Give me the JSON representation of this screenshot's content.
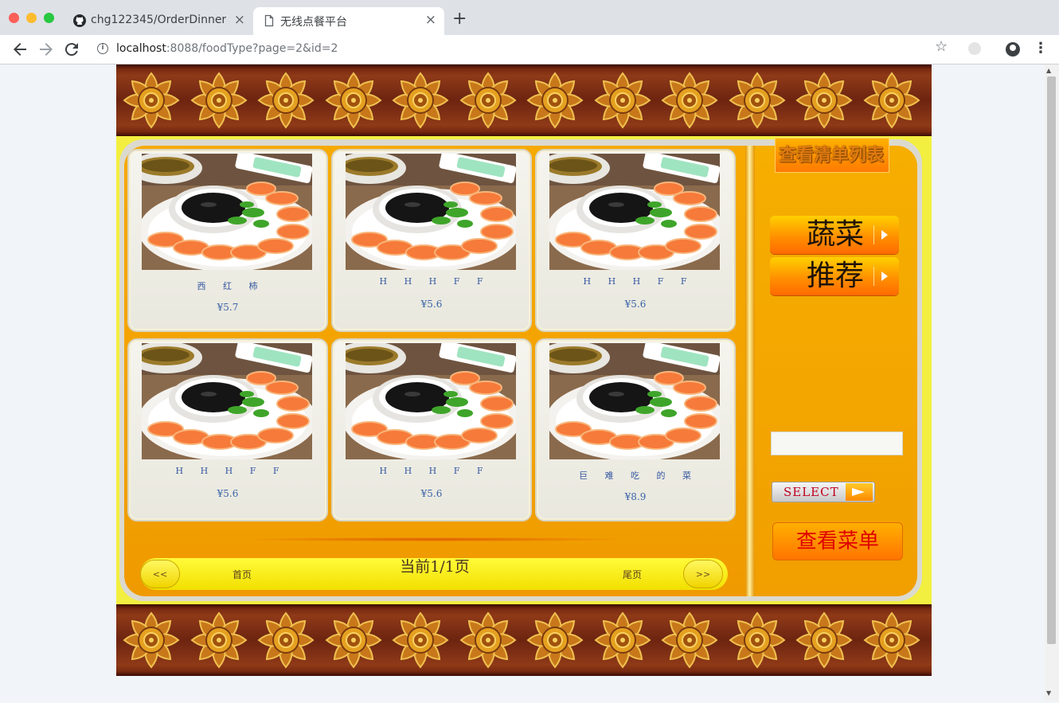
{
  "browser": {
    "tabs": [
      {
        "title": "chg122345/OrderDinner:",
        "icon": "github-icon",
        "active": false
      },
      {
        "title": "无线点餐平台",
        "icon": "page-icon",
        "active": true
      }
    ],
    "new_tab": "+",
    "close_glyph": "×",
    "url_host": "localhost",
    "url_rest": ":8088/foodType?page=2&id=2"
  },
  "site": {
    "cart_button": "查看清单列表",
    "categories": [
      {
        "label": "蔬菜"
      },
      {
        "label": "推荐"
      }
    ],
    "search": {
      "value": ""
    },
    "select_button": "SELECT",
    "menu_button": "查看菜单",
    "foods": [
      {
        "name": "西 红 柿",
        "price": "¥5.7"
      },
      {
        "name": "H H H F F",
        "price": "¥5.6"
      },
      {
        "name": "H H H F F",
        "price": "¥5.6"
      },
      {
        "name": "H H H F F",
        "price": "¥5.6"
      },
      {
        "name": "H H H F F",
        "price": "¥5.6"
      },
      {
        "name": "巨 难 吃 的 菜",
        "price": "¥8.9"
      }
    ],
    "pager": {
      "prev": "<<",
      "first": "首页",
      "status": "当前1/1页",
      "last": "尾页",
      "next": ">>"
    }
  }
}
